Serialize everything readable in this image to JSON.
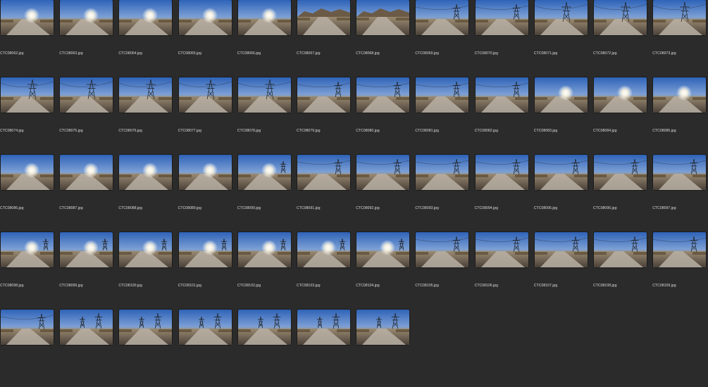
{
  "files": [
    {
      "name": "CTC08062.jpg",
      "scene": "sun-road"
    },
    {
      "name": "CTC08063.jpg",
      "scene": "sun-road"
    },
    {
      "name": "CTC08064.jpg",
      "scene": "sun-road"
    },
    {
      "name": "CTC08065.jpg",
      "scene": "sun-road"
    },
    {
      "name": "CTC08066.jpg",
      "scene": "sun-road"
    },
    {
      "name": "CTC08067.jpg",
      "scene": "hills-road"
    },
    {
      "name": "CTC08068.jpg",
      "scene": "hills-road"
    },
    {
      "name": "CTC08069.jpg",
      "scene": "tower-road"
    },
    {
      "name": "CTC08070.jpg",
      "scene": "tower-road"
    },
    {
      "name": "CTC08071.jpg",
      "scene": "tower-sky"
    },
    {
      "name": "CTC08072.jpg",
      "scene": "tower-sky"
    },
    {
      "name": "CTC08073.jpg",
      "scene": "tower-sky"
    },
    {
      "name": "CTC08074.jpg",
      "scene": "tower-sky"
    },
    {
      "name": "CTC08075.jpg",
      "scene": "tower-sky"
    },
    {
      "name": "CTC08076.jpg",
      "scene": "tower-sky"
    },
    {
      "name": "CTC08077.jpg",
      "scene": "tower-sky"
    },
    {
      "name": "CTC08078.jpg",
      "scene": "tower-sky"
    },
    {
      "name": "CTC08079.jpg",
      "scene": "tower-road"
    },
    {
      "name": "CTC08080.jpg",
      "scene": "tower-road"
    },
    {
      "name": "CTC08081.jpg",
      "scene": "tower-road"
    },
    {
      "name": "CTC08082.jpg",
      "scene": "tower-road"
    },
    {
      "name": "CTC08083.jpg",
      "scene": "sun-road"
    },
    {
      "name": "CTC08084.jpg",
      "scene": "sun-road"
    },
    {
      "name": "CTC08085.jpg",
      "scene": "sun-road"
    },
    {
      "name": "CTC08086.jpg",
      "scene": "sun-road"
    },
    {
      "name": "CTC08087.jpg",
      "scene": "sun-road"
    },
    {
      "name": "CTC08088.jpg",
      "scene": "sun-road"
    },
    {
      "name": "CTC08089.jpg",
      "scene": "sun-road"
    },
    {
      "name": "CTC08090.jpg",
      "scene": "sun-tower"
    },
    {
      "name": "CTC08091.jpg",
      "scene": "tower-road"
    },
    {
      "name": "CTC08092.jpg",
      "scene": "tower-road"
    },
    {
      "name": "CTC08093.jpg",
      "scene": "tower-road"
    },
    {
      "name": "CTC08094.jpg",
      "scene": "tower-road"
    },
    {
      "name": "CTC08095.jpg",
      "scene": "tower-road"
    },
    {
      "name": "CTC08096.jpg",
      "scene": "tower-road"
    },
    {
      "name": "CTC08097.jpg",
      "scene": "tower-road"
    },
    {
      "name": "CTC08098.jpg",
      "scene": "sun-tower"
    },
    {
      "name": "CTC08099.jpg",
      "scene": "sun-tower"
    },
    {
      "name": "CTC08100.jpg",
      "scene": "sun-tower"
    },
    {
      "name": "CTC08101.jpg",
      "scene": "sun-tower"
    },
    {
      "name": "CTC08102.jpg",
      "scene": "sun-tower"
    },
    {
      "name": "CTC08103.jpg",
      "scene": "sun-tower"
    },
    {
      "name": "CTC08104.jpg",
      "scene": "sun-tower"
    },
    {
      "name": "CTC08105.jpg",
      "scene": "tower-road"
    },
    {
      "name": "CTC08106.jpg",
      "scene": "tower-road"
    },
    {
      "name": "CTC08107.jpg",
      "scene": "tower-road"
    },
    {
      "name": "CTC08108.jpg",
      "scene": "tower-road"
    },
    {
      "name": "CTC08109.jpg",
      "scene": "tower-road"
    },
    {
      "name": "",
      "scene": "tower-road"
    },
    {
      "name": "",
      "scene": "towers-far"
    },
    {
      "name": "",
      "scene": "towers-far"
    },
    {
      "name": "",
      "scene": "towers-far"
    },
    {
      "name": "",
      "scene": "towers-far"
    },
    {
      "name": "",
      "scene": "towers-far"
    },
    {
      "name": "",
      "scene": "towers-far"
    }
  ],
  "colors": {
    "background": "#2b2b2b",
    "filename_text": "#d9d9d9"
  }
}
